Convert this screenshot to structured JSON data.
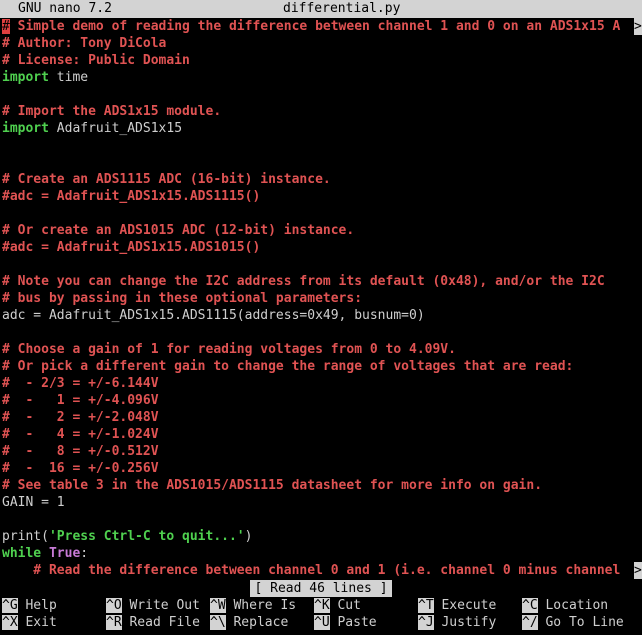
{
  "titlebar": {
    "app": "GNU nano 7.2",
    "filename": "differential.py"
  },
  "lines": [
    {
      "parts": [
        {
          "t": "#",
          "c": "cursor"
        },
        {
          "t": " Simple demo of reading the difference between channel 1 and 0 on an ADS1x15 A",
          "c": "comment"
        },
        {
          "t": ">",
          "c": "arrow"
        }
      ]
    },
    {
      "parts": [
        {
          "t": "# Author: Tony DiCola",
          "c": "comment"
        }
      ]
    },
    {
      "parts": [
        {
          "t": "# License: Public Domain",
          "c": "comment"
        }
      ]
    },
    {
      "parts": [
        {
          "t": "import",
          "c": "kw"
        },
        {
          "t": " time",
          "c": "plain"
        }
      ]
    },
    {
      "parts": []
    },
    {
      "parts": [
        {
          "t": "# Import the ADS1x15 module.",
          "c": "comment"
        }
      ]
    },
    {
      "parts": [
        {
          "t": "import",
          "c": "kw"
        },
        {
          "t": " Adafruit_ADS1x15",
          "c": "plain"
        }
      ]
    },
    {
      "parts": []
    },
    {
      "parts": []
    },
    {
      "parts": [
        {
          "t": "# Create an ADS1115 ADC (16-bit) instance.",
          "c": "comment"
        }
      ]
    },
    {
      "parts": [
        {
          "t": "#adc = Adafruit_ADS1x15.ADS1115()",
          "c": "comment"
        }
      ]
    },
    {
      "parts": []
    },
    {
      "parts": [
        {
          "t": "# Or create an ADS1015 ADC (12-bit) instance.",
          "c": "comment"
        }
      ]
    },
    {
      "parts": [
        {
          "t": "#adc = Adafruit_ADS1x15.ADS1015()",
          "c": "comment"
        }
      ]
    },
    {
      "parts": []
    },
    {
      "parts": [
        {
          "t": "# Note you can change the I2C address from its default (0x48), and/or the I2C",
          "c": "comment"
        }
      ]
    },
    {
      "parts": [
        {
          "t": "# bus by passing in these optional parameters:",
          "c": "comment"
        }
      ]
    },
    {
      "parts": [
        {
          "t": "adc = Adafruit_ADS1x15.ADS1115(address=0x49, busnum=0)",
          "c": "plain"
        }
      ]
    },
    {
      "parts": []
    },
    {
      "parts": [
        {
          "t": "# Choose a gain of 1 for reading voltages from 0 to 4.09V.",
          "c": "comment"
        }
      ]
    },
    {
      "parts": [
        {
          "t": "# Or pick a different gain to change the range of voltages that are read:",
          "c": "comment"
        }
      ]
    },
    {
      "parts": [
        {
          "t": "#  - 2/3 = +/-6.144V",
          "c": "comment"
        }
      ]
    },
    {
      "parts": [
        {
          "t": "#  -   1 = +/-4.096V",
          "c": "comment"
        }
      ]
    },
    {
      "parts": [
        {
          "t": "#  -   2 = +/-2.048V",
          "c": "comment"
        }
      ]
    },
    {
      "parts": [
        {
          "t": "#  -   4 = +/-1.024V",
          "c": "comment"
        }
      ]
    },
    {
      "parts": [
        {
          "t": "#  -   8 = +/-0.512V",
          "c": "comment"
        }
      ]
    },
    {
      "parts": [
        {
          "t": "#  -  16 = +/-0.256V",
          "c": "comment"
        }
      ]
    },
    {
      "parts": [
        {
          "t": "# See table 3 in the ADS1015/ADS1115 datasheet for more info on gain.",
          "c": "comment"
        }
      ]
    },
    {
      "parts": [
        {
          "t": "GAIN = 1",
          "c": "plain"
        }
      ]
    },
    {
      "parts": []
    },
    {
      "parts": [
        {
          "t": "print(",
          "c": "plain"
        },
        {
          "t": "'Press Ctrl-C to quit...'",
          "c": "str-g"
        },
        {
          "t": ")",
          "c": "plain"
        }
      ]
    },
    {
      "parts": [
        {
          "t": "while",
          "c": "kw"
        },
        {
          "t": " ",
          "c": "plain"
        },
        {
          "t": "True",
          "c": "true"
        },
        {
          "t": ":",
          "c": "plain"
        }
      ]
    },
    {
      "parts": [
        {
          "t": "    # Read the difference between channel 0 and 1 (i.e. channel 0 minus channel",
          "c": "comment"
        },
        {
          "t": ">",
          "c": "arrow"
        }
      ]
    }
  ],
  "status": "[ Read 46 lines ]",
  "shortcuts": [
    [
      {
        "k": "^G",
        "l": "Help"
      },
      {
        "k": "^O",
        "l": "Write Out"
      },
      {
        "k": "^W",
        "l": "Where Is"
      },
      {
        "k": "^K",
        "l": "Cut"
      },
      {
        "k": "^T",
        "l": "Execute"
      },
      {
        "k": "^C",
        "l": "Location"
      }
    ],
    [
      {
        "k": "^X",
        "l": "Exit"
      },
      {
        "k": "^R",
        "l": "Read File"
      },
      {
        "k": "^\\",
        "l": "Replace"
      },
      {
        "k": "^U",
        "l": "Paste"
      },
      {
        "k": "^J",
        "l": "Justify"
      },
      {
        "k": "^/",
        "l": "Go To Line"
      }
    ]
  ]
}
